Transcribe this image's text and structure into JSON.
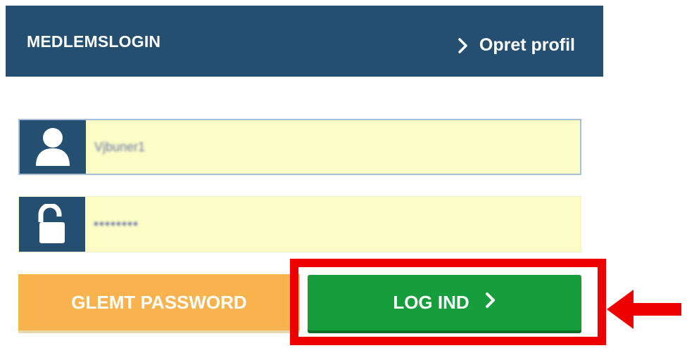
{
  "header": {
    "title": "MEDLEMSLOGIN",
    "create_profile_label": "Opret profil",
    "background_color": "#244f71"
  },
  "form": {
    "username": {
      "value": "Vjbuner1",
      "icon": "user-icon"
    },
    "password": {
      "value": "••••••••",
      "icon": "unlock-icon"
    },
    "field_background": "#fbfcc6"
  },
  "buttons": {
    "forgot_password_label": "GLEMT PASSWORD",
    "forgot_password_color": "#f8b34e",
    "login_label": "LOG IND",
    "login_color": "#169d3c"
  },
  "annotation": {
    "highlight_color": "#ef0000",
    "arrow_icon": "arrow-left-icon"
  }
}
